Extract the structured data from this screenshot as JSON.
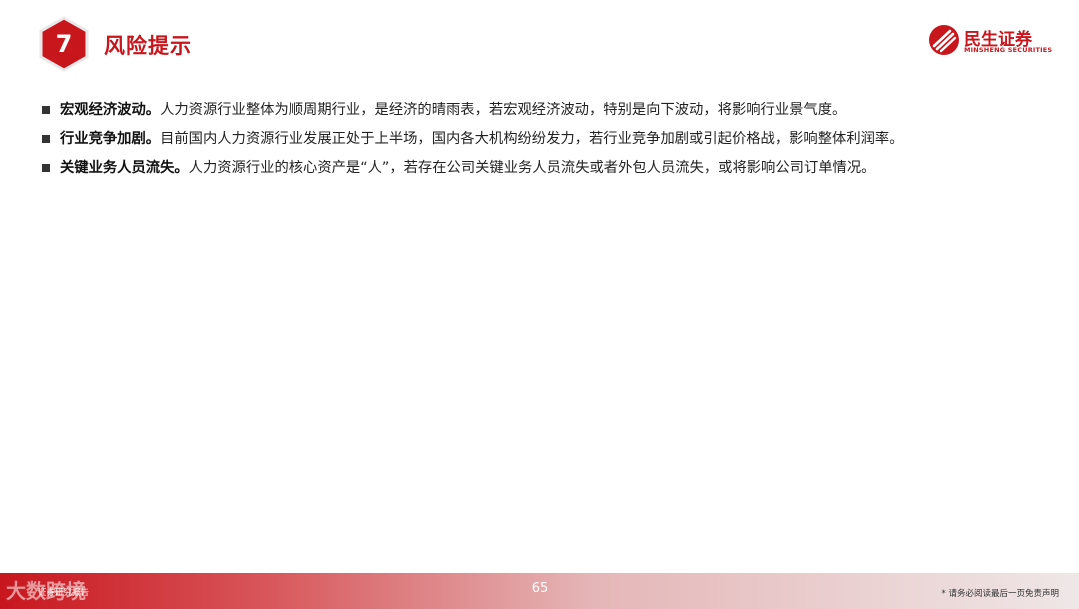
{
  "header": {
    "section_number": "7",
    "section_title": "风险提示"
  },
  "logo": {
    "name_cn": "民生证券",
    "name_en": "MINSHENG SECURITIES",
    "brand_color": "#c8161d"
  },
  "bullets": [
    {
      "title": "宏观经济波动。",
      "text": "人力资源行业整体为顺周期行业，是经济的晴雨表，若宏观经济波动，特别是向下波动，将影响行业景气度。"
    },
    {
      "title": "行业竞争加剧。",
      "text": "目前国内人力资源行业发展正处于上半场，国内各大机构纷纷发力，若行业竞争加剧或引起价格战，影响整体利润率。"
    },
    {
      "title": "关键业务人员流失。",
      "text": "人力资源行业的核心资产是“人”，若存在公司关键业务人员流失或者外包人员流失，或将影响公司订单情况。"
    }
  ],
  "footer": {
    "watermark": "大数跨境",
    "left_label": "证券研究报告",
    "page_number": "65",
    "disclaimer": "* 请务必阅读最后一页免责声明"
  }
}
